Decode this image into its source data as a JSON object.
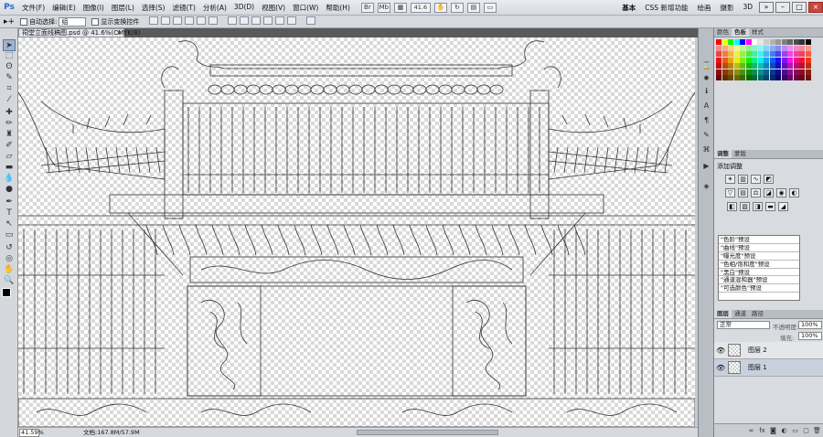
{
  "app": {
    "logo": "Ps"
  },
  "menu": [
    "文件(F)",
    "编辑(E)",
    "图像(I)",
    "图层(L)",
    "选择(S)",
    "滤镜(T)",
    "分析(A)",
    "3D(D)",
    "视图(V)",
    "窗口(W)",
    "帮助(H)"
  ],
  "menubar_controls": {
    "zoom_level": "41.6"
  },
  "workspaces": [
    "基本",
    "CSS 新增功能",
    "绘画",
    "摄影",
    "3D"
  ],
  "workspace_active": "基本",
  "window_controls": [
    "»",
    "–",
    "□",
    "×"
  ],
  "options": {
    "auto_select_label": "自动选择:",
    "auto_select_value": "组",
    "show_transform_label": "显示变换控件"
  },
  "document": {
    "tab_title": "祠堂立面线稿图.psd @ 41.6%(CMYK/8)",
    "close": "×"
  },
  "status": {
    "zoom": "41.59%",
    "doc_size": "文档:167.8M/57.9M"
  },
  "panels": {
    "color_tabs": [
      "颜色",
      "色板",
      "样式"
    ],
    "adjustments_tabs": [
      "调整",
      "蒙版"
    ],
    "adjustments_title": "添加调整",
    "presets": [
      "\"色阶\"预设",
      "\"曲线\"预设",
      "\"曝光度\"预设",
      "\"色相/饱和度\"预设",
      "\"黑白\"预设",
      "\"通道混和器\"预设",
      "\"可选颜色\"预设"
    ],
    "layers_tabs": [
      "图层",
      "通道",
      "路径"
    ],
    "blend_mode": "正常",
    "opacity_label": "不透明度:",
    "opacity": "100%",
    "fill_label": "填充:",
    "fill": "100%",
    "layers": [
      {
        "name": "图层 2"
      },
      {
        "name": "图层 1"
      }
    ]
  },
  "colors": {
    "chrome": "#d6d9de",
    "canvas_line": "#333333"
  }
}
